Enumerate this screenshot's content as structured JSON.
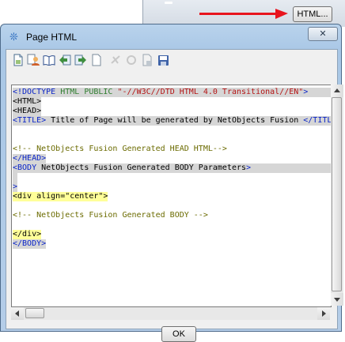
{
  "background": {
    "html_button_label": "HTML...",
    "arrow_color": "#e8141e"
  },
  "dialog": {
    "title": "Page HTML",
    "title_icon": "gear-snowflake-icon",
    "close_label": "✕",
    "ok_label": "OK"
  },
  "toolbar": {
    "icons": [
      "new-page-icon",
      "person-icon",
      "book-icon",
      "arrow-left-icon",
      "arrow-right-icon",
      "document-icon",
      "disabled-icon",
      "disabled-icon",
      "page-icon",
      "save-icon"
    ]
  },
  "editor": {
    "lines": [
      {
        "text": "<!DOCTYPE HTML PUBLIC \"-//W3C//DTD HTML 4.0 Transitional//EN\">",
        "style": "doctype"
      },
      {
        "text": "<HTML>",
        "style": "tag"
      },
      {
        "text": "<HEAD>",
        "style": "tag"
      },
      {
        "text": "<TITLE> Title of Page will be generated by NetObjects Fusion </TITLE>",
        "style": "title"
      },
      {
        "text": "",
        "style": "blank"
      },
      {
        "text": "",
        "style": "blank"
      },
      {
        "text": "<!-- NetObjects Fusion Generated HEAD HTML-->",
        "style": "comment"
      },
      {
        "text": "</HEAD>",
        "style": "tag"
      },
      {
        "text": "<BODY NetObjects Fusion Generated BODY Parameters>",
        "style": "body"
      },
      {
        "text": "",
        "style": "blank-gray"
      },
      {
        "text": ">",
        "style": "tag"
      },
      {
        "text": "<div align=\"center\">",
        "style": "div"
      },
      {
        "text": "",
        "style": "blank"
      },
      {
        "text": "<!-- NetObjects Fusion Generated BODY -->",
        "style": "comment"
      },
      {
        "text": "",
        "style": "blank"
      },
      {
        "text": "</div>",
        "style": "div"
      },
      {
        "text": "</BODY>",
        "style": "tag"
      }
    ]
  }
}
